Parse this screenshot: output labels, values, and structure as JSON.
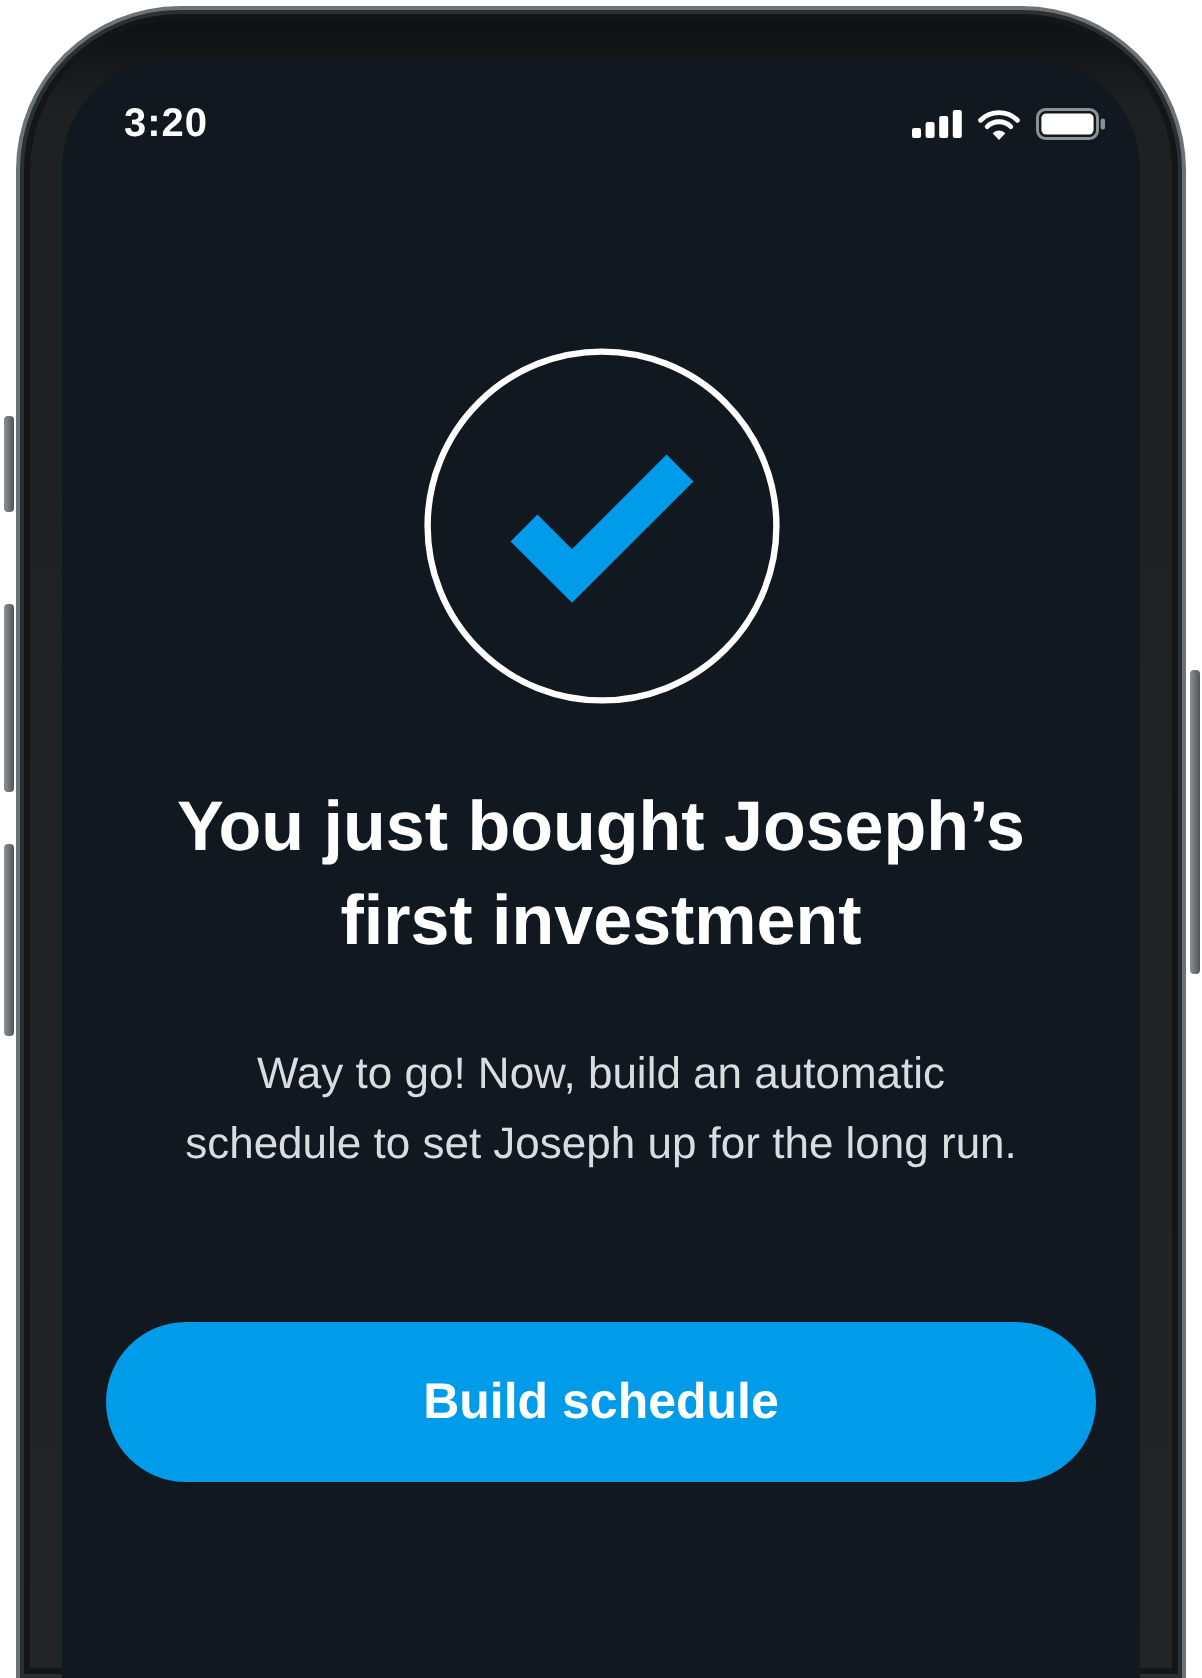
{
  "status_bar": {
    "time": "3:20"
  },
  "confirmation": {
    "title": "You just bought Joseph’s first investment",
    "message": "Way to go! Now, build an automatic schedule to set Joseph up for the long run."
  },
  "actions": [
    {
      "kind": "primary",
      "label": "Build schedule"
    }
  ]
}
